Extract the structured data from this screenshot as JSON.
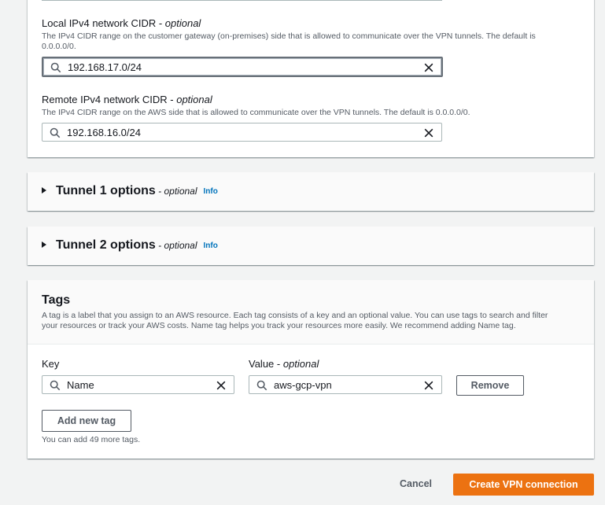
{
  "local_cidr": {
    "label": "Local IPv4 network CIDR - ",
    "label_optional": "optional",
    "description_line1": "The IPv4 CIDR range on the customer gateway (on-premises) side that is allowed to communicate over the VPN tunnels. The default is",
    "description_line2": "0.0.0.0/0.",
    "value": "192.168.17.0/24"
  },
  "remote_cidr": {
    "label": "Remote IPv4 network CIDR - ",
    "label_optional": "optional",
    "description": "The IPv4 CIDR range on the AWS side that is allowed to communicate over the VPN tunnels. The default is 0.0.0.0/0.",
    "value": "192.168.16.0/24"
  },
  "tunnel1": {
    "title": "Tunnel 1 options",
    "optional": " - optional",
    "info": "Info"
  },
  "tunnel2": {
    "title": "Tunnel 2 options",
    "optional": " - optional",
    "info": "Info"
  },
  "tags": {
    "title": "Tags",
    "description_line1": "A tag is a label that you assign to an AWS resource. Each tag consists of a key and an optional value. You can use tags to search and filter",
    "description_line2": "your resources or track your AWS costs. Name tag helps you track your resources more easily. We recommend adding Name tag.",
    "key_label": "Key",
    "value_label": "Value - ",
    "value_label_optional": "optional",
    "rows": [
      {
        "key": "Name",
        "value": "aws-gcp-vpn"
      }
    ],
    "remove_label": "Remove",
    "add_label": "Add new tag",
    "remaining": "You can add 49 more tags."
  },
  "footer": {
    "cancel": "Cancel",
    "create": "Create VPN connection"
  },
  "colors": {
    "primary": "#ec7211",
    "info_link": "#0073bb",
    "background": "#f2f3f3"
  },
  "icons": [
    "search-icon",
    "close-icon",
    "caret-right-icon"
  ]
}
